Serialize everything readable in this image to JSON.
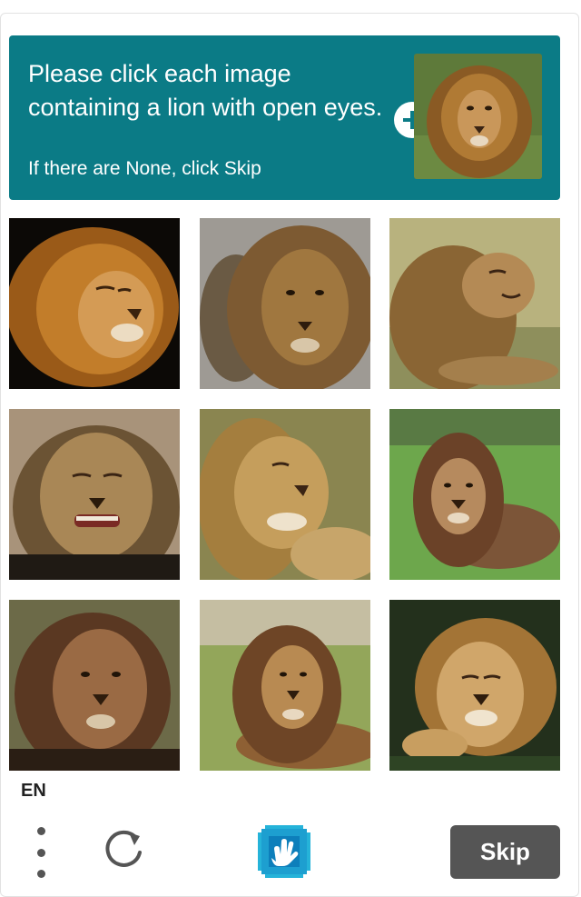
{
  "prompt": {
    "main_text": "Please click each image containing a lion with open eyes.",
    "sub_text": "If there are None, click Skip",
    "example_image": {
      "alt": "lion with open eyes example"
    },
    "plus_icon": "plus-icon"
  },
  "grid": {
    "tiles": [
      {
        "name": "lion-image-1",
        "eyes": "closed",
        "background": "black"
      },
      {
        "name": "lion-image-2",
        "eyes": "open",
        "background": "gray"
      },
      {
        "name": "lion-image-3",
        "eyes": "closed",
        "background": "grass"
      },
      {
        "name": "lion-image-4",
        "eyes": "closed",
        "background": "dirt"
      },
      {
        "name": "lion-image-5",
        "eyes": "closed",
        "background": "grass"
      },
      {
        "name": "lion-image-6",
        "eyes": "open",
        "background": "green"
      },
      {
        "name": "lion-image-7",
        "eyes": "open",
        "background": "dark"
      },
      {
        "name": "lion-image-8",
        "eyes": "open",
        "background": "grass"
      },
      {
        "name": "lion-image-9",
        "eyes": "closed",
        "background": "dark-green"
      }
    ]
  },
  "footer": {
    "language": "EN",
    "menu_icon": "more-vertical-icon",
    "refresh_icon": "refresh-icon",
    "logo_icon": "hcaptcha-hand-logo-icon",
    "skip_label": "Skip"
  },
  "colors": {
    "accent": "#0b7b86",
    "skip_button": "#555555"
  }
}
